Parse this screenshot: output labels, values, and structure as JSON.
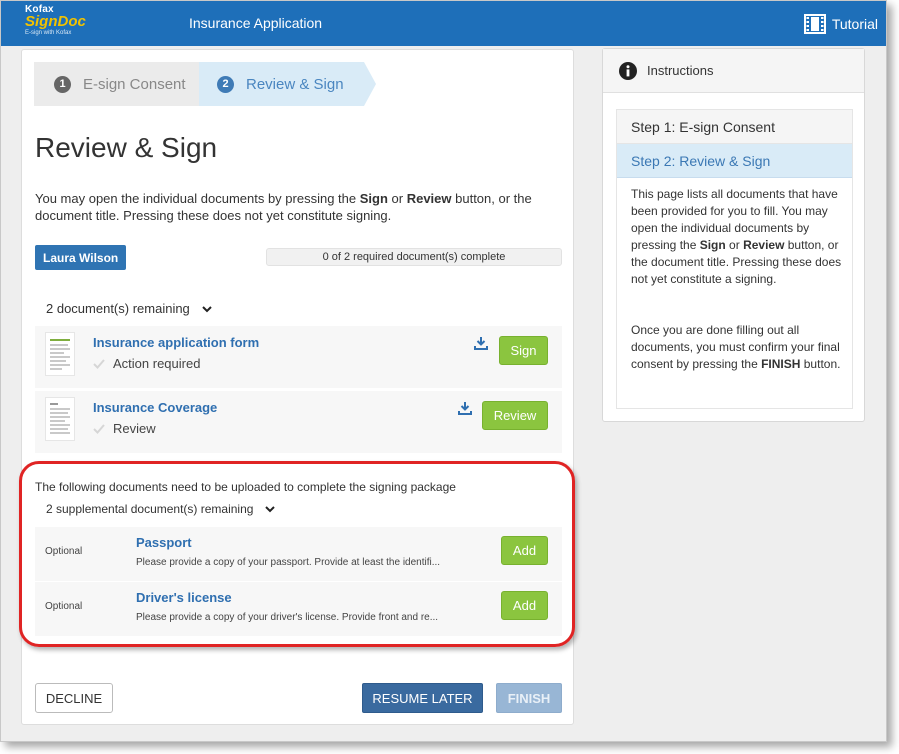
{
  "header": {
    "logo_line1": "Kofax",
    "logo_line2": "SignDoc",
    "logo_line3": "E-sign with Kofax",
    "app_title": "Insurance Application",
    "tutorial_label": "Tutorial",
    "color": "#1e6fb9"
  },
  "steps": [
    {
      "num": "1",
      "label": "E-sign Consent"
    },
    {
      "num": "2",
      "label": "Review & Sign"
    }
  ],
  "page_title": "Review & Sign",
  "intro": {
    "t1": "You may open the individual documents by pressing the ",
    "b1": "Sign",
    "t2": " or ",
    "b2": "Review",
    "t3": " button, or the document title. Pressing these does not yet constitute signing."
  },
  "signer": "Laura Wilson",
  "progress_text": "0 of 2 required document(s) complete",
  "remaining_label": "2 document(s) remaining",
  "documents": [
    {
      "title": "Insurance application form",
      "status": "Action required",
      "button": "Sign"
    },
    {
      "title": "Insurance Coverage",
      "status": "Review",
      "button": "Review"
    }
  ],
  "upload_text": "The following documents need to be uploaded to complete the signing package",
  "supp_remaining_label": "2 supplemental document(s) remaining",
  "supplemental": [
    {
      "optional": "Optional",
      "title": "Passport",
      "desc": "Please provide a copy of your passport. Provide at least the identifi...",
      "button": "Add"
    },
    {
      "optional": "Optional",
      "title": "Driver's license",
      "desc": "Please provide a copy of your driver's license. Provide front and re...",
      "button": "Add"
    }
  ],
  "footer": {
    "decline": "DECLINE",
    "resume": "RESUME LATER",
    "finish": "FINISH"
  },
  "instructions": {
    "title": "Instructions",
    "step1": "Step 1: E-sign Consent",
    "step2": "Step 2: Review & Sign",
    "p1_t1": "This page lists all documents that have been provided for you to fill. You may open the individual documents by pressing the ",
    "p1_b1": "Sign",
    "p1_t2": " or ",
    "p1_b2": "Review",
    "p1_t3": " button, or the document title. Pressing these does not yet constitute a signing.",
    "p2_t1": "Once you are done filling out all documents, you must confirm your final consent by pressing the ",
    "p2_b1": "FINISH",
    "p2_t2": " button."
  },
  "colors": {
    "accent_blue": "#1e6fb9",
    "link_blue": "#2f6fb0",
    "green_button": "#8bc53f",
    "highlight_red": "#e02424"
  }
}
